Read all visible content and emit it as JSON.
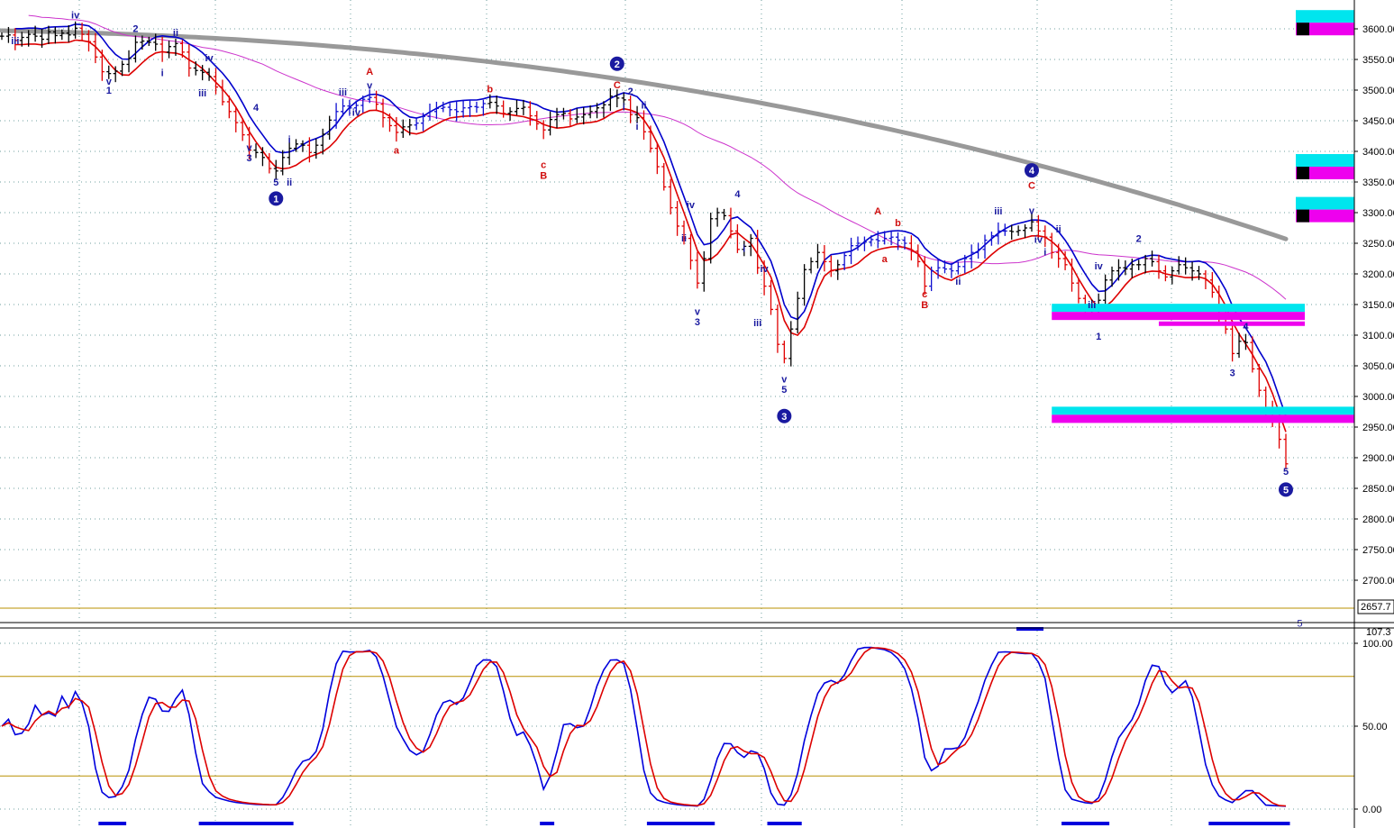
{
  "chart_data": {
    "type": "line",
    "price_axis": {
      "ticks": [
        "3600.00",
        "3550.00",
        "3500.00",
        "3450.00",
        "3400.00",
        "3350.00",
        "3300.00",
        "3250.00",
        "3200.00",
        "3150.00",
        "3100.00",
        "3050.00",
        "3000.00",
        "2950.00",
        "2900.00",
        "2850.00",
        "2800.00",
        "2750.00",
        "2700.00"
      ],
      "tick_values": [
        3600,
        3550,
        3500,
        3450,
        3400,
        3350,
        3300,
        3250,
        3200,
        3150,
        3100,
        3050,
        3000,
        2950,
        2900,
        2850,
        2800,
        2750,
        2700
      ],
      "range": [
        2645,
        3650
      ],
      "last_label": "2657.7"
    },
    "osc_axis": {
      "ticks": [
        "100.00",
        "50.00",
        "0.00"
      ],
      "tick_values": [
        100,
        50,
        0
      ],
      "top_label": "107.3",
      "range": [
        -2,
        107.3
      ],
      "band_lines": [
        80,
        20
      ]
    },
    "colors": {
      "price_up": "#000000",
      "price_down": "#e00000",
      "price_blue": "#1010d0",
      "upper_band": "#0000cc",
      "lower_band": "#dd0000",
      "ma_magenta": "#cc33cc",
      "ma_gray": "#999999",
      "stoch_fast": "#0000dd",
      "stoch_slow": "#dd0000",
      "zone_cyan": "#00e5ee",
      "zone_magenta": "#ee00ee",
      "band_line": "#b89000",
      "grid": "#6f9f9f"
    },
    "wave_labels": [
      {
        "text": "iii",
        "color": "#1a1aa0",
        "i": 2,
        "price": 3575
      },
      {
        "text": "iv",
        "color": "#1a1aa0",
        "i": 11,
        "price": 3617
      },
      {
        "text": "2",
        "color": "#1a1aa0",
        "i": 20,
        "price": 3595
      },
      {
        "text": "v",
        "color": "#1a1aa0",
        "i": 16,
        "price": 3509
      },
      {
        "text": "1",
        "color": "#1a1aa0",
        "i": 16,
        "price": 3494
      },
      {
        "text": "ii",
        "color": "#1a1aa0",
        "i": 26,
        "price": 3588
      },
      {
        "text": "i",
        "color": "#1a1aa0",
        "i": 24,
        "price": 3523
      },
      {
        "text": "iv",
        "color": "#1a1aa0",
        "i": 31,
        "price": 3547
      },
      {
        "text": "iii",
        "color": "#1a1aa0",
        "i": 30,
        "price": 3490
      },
      {
        "text": "4",
        "color": "#1a1aa0",
        "i": 38,
        "price": 3466
      },
      {
        "text": "v",
        "color": "#1a1aa0",
        "i": 37,
        "price": 3401
      },
      {
        "text": "3",
        "color": "#1a1aa0",
        "i": 37,
        "price": 3384
      },
      {
        "text": "i",
        "color": "#1a1aa0",
        "i": 43,
        "price": 3414
      },
      {
        "text": "5",
        "color": "#1a1aa0",
        "i": 41,
        "price": 3344
      },
      {
        "text": "ii",
        "color": "#1a1aa0",
        "i": 43,
        "price": 3344
      },
      {
        "text": "iii",
        "color": "#1a1aa0",
        "i": 51,
        "price": 3491
      },
      {
        "text": "iv",
        "color": "#1a1aa0",
        "i": 53,
        "price": 3458
      },
      {
        "text": "v",
        "color": "#1a1aa0",
        "i": 55,
        "price": 3502
      },
      {
        "text": "A",
        "color": "#d01010",
        "i": 55,
        "price": 3525
      },
      {
        "text": "a",
        "color": "#d01010",
        "i": 59,
        "price": 3396
      },
      {
        "text": "b",
        "color": "#d01010",
        "i": 73,
        "price": 3496
      },
      {
        "text": "c",
        "color": "#d01010",
        "i": 81,
        "price": 3373
      },
      {
        "text": "B",
        "color": "#d01010",
        "i": 81,
        "price": 3355
      },
      {
        "text": "C",
        "color": "#d01010",
        "i": 92,
        "price": 3503
      },
      {
        "text": "2",
        "color": "#1a1aa0",
        "i": 94,
        "price": 3493
      },
      {
        "text": "i",
        "color": "#1a1aa0",
        "i": 93,
        "price": 3467
      },
      {
        "text": "ii",
        "color": "#1a1aa0",
        "i": 96,
        "price": 3470
      },
      {
        "text": "i",
        "color": "#1a1aa0",
        "i": 95,
        "price": 3435
      },
      {
        "text": "iv",
        "color": "#1a1aa0",
        "i": 103,
        "price": 3307
      },
      {
        "text": "4",
        "color": "#1a1aa0",
        "i": 110,
        "price": 3325
      },
      {
        "text": "ii",
        "color": "#1a1aa0",
        "i": 102,
        "price": 3253
      },
      {
        "text": "i",
        "color": "#1a1aa0",
        "i": 111,
        "price": 3236
      },
      {
        "text": "iv",
        "color": "#1a1aa0",
        "i": 114,
        "price": 3203
      },
      {
        "text": "v",
        "color": "#1a1aa0",
        "i": 104,
        "price": 3133
      },
      {
        "text": "3",
        "color": "#1a1aa0",
        "i": 104,
        "price": 3116
      },
      {
        "text": "iii",
        "color": "#1a1aa0",
        "i": 113,
        "price": 3115
      },
      {
        "text": "v",
        "color": "#1a1aa0",
        "i": 117,
        "price": 3023
      },
      {
        "text": "5",
        "color": "#1a1aa0",
        "i": 117,
        "price": 3006
      },
      {
        "text": "A",
        "color": "#d01010",
        "i": 131,
        "price": 3297
      },
      {
        "text": "b",
        "color": "#d01010",
        "i": 134,
        "price": 3278
      },
      {
        "text": "a",
        "color": "#d01010",
        "i": 132,
        "price": 3219
      },
      {
        "text": "c",
        "color": "#d01010",
        "i": 138,
        "price": 3162
      },
      {
        "text": "B",
        "color": "#d01010",
        "i": 138,
        "price": 3144
      },
      {
        "text": "iii",
        "color": "#1a1aa0",
        "i": 149,
        "price": 3297
      },
      {
        "text": "v",
        "color": "#1a1aa0",
        "i": 154,
        "price": 3298
      },
      {
        "text": "iv",
        "color": "#1a1aa0",
        "i": 155,
        "price": 3251
      },
      {
        "text": "ii",
        "color": "#1a1aa0",
        "i": 143,
        "price": 3182
      },
      {
        "text": "ii",
        "color": "#1a1aa0",
        "i": 158,
        "price": 3268
      },
      {
        "text": "C",
        "color": "#d01010",
        "i": 154,
        "price": 3339
      },
      {
        "text": "i",
        "color": "#1a1aa0",
        "i": 156,
        "price": 3230
      },
      {
        "text": "iv",
        "color": "#1a1aa0",
        "i": 164,
        "price": 3207
      },
      {
        "text": "iii",
        "color": "#1a1aa0",
        "i": 163,
        "price": 3144
      },
      {
        "text": "1",
        "color": "#1a1aa0",
        "i": 164,
        "price": 3093
      },
      {
        "text": "2",
        "color": "#1a1aa0",
        "i": 170,
        "price": 3252
      },
      {
        "text": "3",
        "color": "#1a1aa0",
        "i": 184,
        "price": 3033
      },
      {
        "text": "4",
        "color": "#1a1aa0",
        "i": 186,
        "price": 3109
      },
      {
        "text": "5",
        "color": "#1a1aa0",
        "i": 192,
        "price": 2872
      }
    ],
    "circled_labels": [
      {
        "text": "1",
        "i": 41,
        "price": 3323
      },
      {
        "text": "2",
        "i": 92,
        "price": 3543
      },
      {
        "text": "3",
        "i": 117,
        "price": 2968
      },
      {
        "text": "4",
        "i": 154,
        "price": 3369
      },
      {
        "text": "5",
        "i": 192,
        "price": 2848
      }
    ],
    "zones": [
      {
        "name": "zone-3138",
        "from_i": 157,
        "price": 3138,
        "cyan": true
      },
      {
        "name": "zone-3118",
        "from_i": 173,
        "price": 3118,
        "cyan": false
      },
      {
        "name": "zone-2970",
        "from_i": 157,
        "price": 2970,
        "cyan": true
      },
      {
        "name": "zone-top-3600",
        "from_i": 195,
        "price": 3610,
        "cyan": true
      },
      {
        "name": "zone-top-3375",
        "from_i": 195,
        "price": 3375,
        "cyan": true
      },
      {
        "name": "zone-top-3305",
        "from_i": 195,
        "price": 3305,
        "cyan": true
      }
    ],
    "extra_text": [
      {
        "text": "5",
        "i": 193,
        "price": 2651
      }
    ],
    "closes": [
      3588,
      3590,
      3581,
      3586,
      3591,
      3588,
      3583,
      3595,
      3589,
      3593,
      3590,
      3601,
      3591,
      3579,
      3554,
      3530,
      3527,
      3531,
      3542,
      3552,
      3578,
      3580,
      3578,
      3575,
      3562,
      3571,
      3576,
      3562,
      3536,
      3532,
      3529,
      3522,
      3505,
      3481,
      3465,
      3447,
      3427,
      3402,
      3398,
      3390,
      3372,
      3368,
      3390,
      3405,
      3412,
      3410,
      3398,
      3410,
      3428,
      3451,
      3465,
      3474,
      3471,
      3475,
      3485,
      3488,
      3477,
      3455,
      3442,
      3431,
      3440,
      3443,
      3446,
      3457,
      3465,
      3470,
      3472,
      3468,
      3465,
      3471,
      3473,
      3472,
      3478,
      3480,
      3474,
      3462,
      3465,
      3470,
      3472,
      3458,
      3445,
      3435,
      3452,
      3460,
      3462,
      3453,
      3456,
      3460,
      3465,
      3471,
      3476,
      3490,
      3487,
      3484,
      3460,
      3455,
      3432,
      3405,
      3375,
      3342,
      3308,
      3278,
      3258,
      3222,
      3185,
      3225,
      3290,
      3300,
      3295,
      3270,
      3240,
      3245,
      3258,
      3210,
      3180,
      3142,
      3085,
      3062,
      3110,
      3160,
      3207,
      3220,
      3235,
      3220,
      3205,
      3215,
      3230,
      3246,
      3250,
      3252,
      3256,
      3254,
      3258,
      3260,
      3255,
      3250,
      3237,
      3220,
      3180,
      3205,
      3210,
      3208,
      3205,
      3212,
      3225,
      3235,
      3240,
      3255,
      3262,
      3270,
      3270,
      3269,
      3271,
      3275,
      3285,
      3270,
      3260,
      3235,
      3225,
      3215,
      3185,
      3160,
      3145,
      3140,
      3157,
      3190,
      3205,
      3210,
      3208,
      3215,
      3215,
      3225,
      3220,
      3205,
      3195,
      3205,
      3215,
      3210,
      3205,
      3200,
      3190,
      3170,
      3130,
      3110,
      3070,
      3090,
      3088,
      3045,
      3010,
      2980,
      2960,
      2930,
      2890
    ]
  }
}
